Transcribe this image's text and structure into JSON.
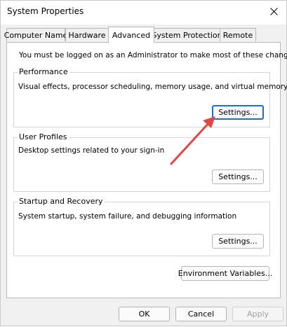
{
  "window": {
    "title": "System Properties"
  },
  "tabs": [
    {
      "label": "Computer Name",
      "active": false
    },
    {
      "label": "Hardware",
      "active": false
    },
    {
      "label": "Advanced",
      "active": true
    },
    {
      "label": "System Protection",
      "active": false
    },
    {
      "label": "Remote",
      "active": false
    }
  ],
  "advanced": {
    "intro": "You must be logged on as an Administrator to make most of these changes.",
    "performance": {
      "label": "Performance",
      "description": "Visual effects, processor scheduling, memory usage, and virtual memory",
      "button": "Settings..."
    },
    "user_profiles": {
      "label": "User Profiles",
      "description": "Desktop settings related to your sign-in",
      "button": "Settings..."
    },
    "startup_recovery": {
      "label": "Startup and Recovery",
      "description": "System startup, system failure, and debugging information",
      "button": "Settings..."
    },
    "environment_button": "Environment Variables..."
  },
  "footer": {
    "ok": "OK",
    "cancel": "Cancel",
    "apply": "Apply"
  },
  "colors": {
    "annotation_arrow": "#e04848",
    "focus_border": "#1a6fc9"
  }
}
